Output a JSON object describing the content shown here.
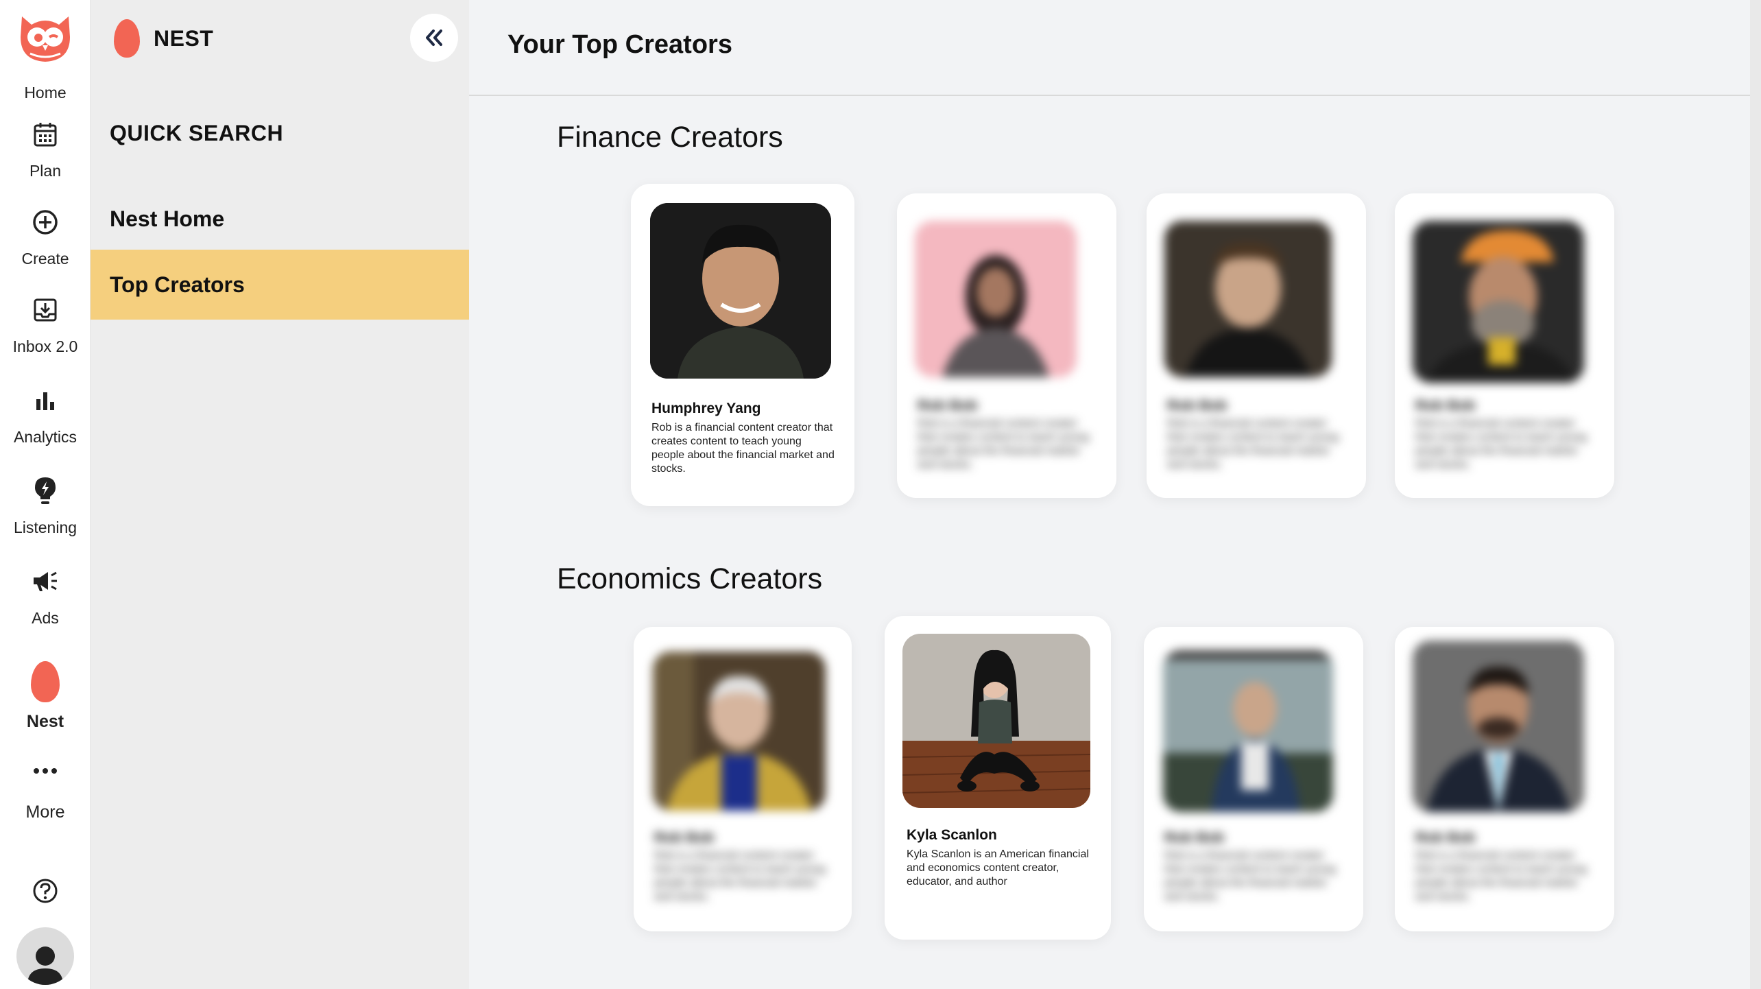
{
  "rail": {
    "items": [
      {
        "label": "Home",
        "icon": "owl-logo-icon"
      },
      {
        "label": "Plan",
        "icon": "calendar-icon"
      },
      {
        "label": "Create",
        "icon": "plus-circle-icon"
      },
      {
        "label": "Inbox 2.0",
        "icon": "inbox-icon"
      },
      {
        "label": "Analytics",
        "icon": "bar-chart-icon"
      },
      {
        "label": "Listening",
        "icon": "bulb-icon"
      },
      {
        "label": "Ads",
        "icon": "megaphone-icon"
      },
      {
        "label": "Nest",
        "icon": "egg-icon"
      },
      {
        "label": "More",
        "icon": "more-dots-icon"
      }
    ]
  },
  "sidebar": {
    "brand": "NEST",
    "heading": "QUICK SEARCH",
    "items": [
      {
        "label": "Nest Home",
        "active": false
      },
      {
        "label": "Top Creators",
        "active": true
      }
    ]
  },
  "main": {
    "title": "Your Top Creators",
    "sections": [
      {
        "title": "Finance Creators",
        "cards": [
          {
            "name": "Humphrey Yang",
            "desc": "Rob is a financial content creator that creates content to teach young people about the financial market and stocks.",
            "focused": true
          },
          {
            "name": "Rob Bob",
            "desc": "Rob is a financial content creator that creates content to teach young people about the financial market and stocks.",
            "focused": false
          },
          {
            "name": "Rob Bob",
            "desc": "Rob is a financial content creator that creates content to teach young people about the financial market and stocks.",
            "focused": false
          },
          {
            "name": "Rob Bob",
            "desc": "Rob is a financial content creator that creates content to teach young people about the financial market and stocks.",
            "focused": false
          }
        ]
      },
      {
        "title": "Economics Creators",
        "cards": [
          {
            "name": "Rob Bob",
            "desc": "Rob is a financial content creator that creates content to teach young people about the financial market and stocks.",
            "focused": false
          },
          {
            "name": "Kyla Scanlon",
            "desc": "Kyla Scanlon is an American financial and economics content creator, educator, and author",
            "focused": true
          },
          {
            "name": "Rob Bob",
            "desc": "Rob is a financial content creator that creates content to teach young people about the financial market and stocks.",
            "focused": false
          },
          {
            "name": "Rob Bob",
            "desc": "Rob is a financial content creator that creates content to teach young people about the financial market and stocks.",
            "focused": false
          }
        ]
      }
    ]
  },
  "colors": {
    "accent": "#f26554",
    "active_nav": "#f5cf7e",
    "nav_dark": "#1f2a44"
  }
}
